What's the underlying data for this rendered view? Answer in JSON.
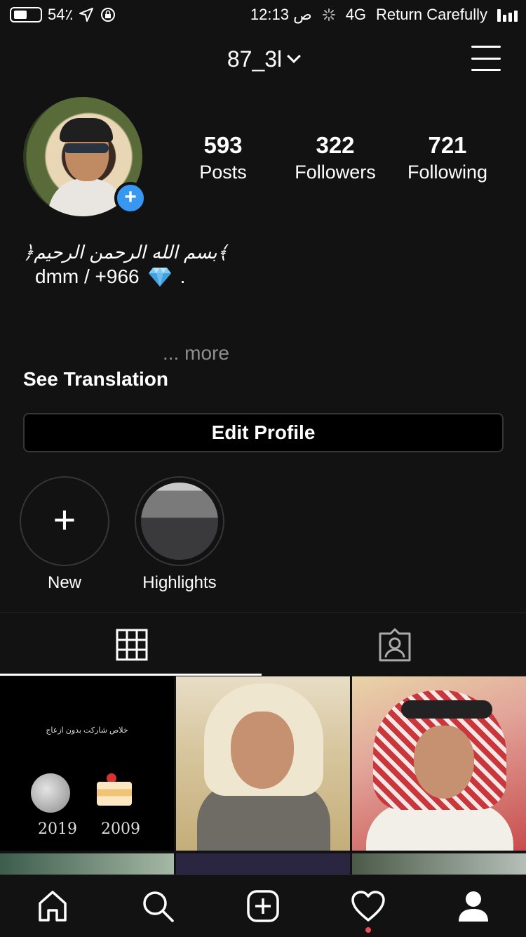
{
  "status_bar": {
    "battery": "54٪",
    "time": "12:13 ص",
    "network": "4G",
    "carrier": "Return Carefully"
  },
  "header": {
    "username": "87_3l"
  },
  "profile": {
    "stats": [
      {
        "value": "593",
        "label": "Posts"
      },
      {
        "value": "322",
        "label": "Followers"
      },
      {
        "value": "721",
        "label": "Following"
      }
    ],
    "bio_arabic": "﴿بسم الله الرحمن الرحيم﴾",
    "bio_line": "dmm / +966",
    "bio_trailing": ".",
    "more_label": "... more",
    "see_translation": "See Translation",
    "edit_profile": "Edit Profile"
  },
  "highlights": [
    {
      "label": "New"
    },
    {
      "label": "Highlights"
    }
  ],
  "grid": {
    "first_post_caption": "خلاص شاركت بدون ازعاج",
    "first_post_years": [
      "2019",
      "2009"
    ]
  },
  "colors": {
    "background": "#121212",
    "accent_blue": "#3897f0",
    "notification": "#ed4956"
  },
  "icons": {
    "nav": [
      "home-icon",
      "search-icon",
      "new-post-icon",
      "activity-heart-icon",
      "profile-icon"
    ],
    "tabs": [
      "grid-icon",
      "tagged-icon"
    ]
  }
}
